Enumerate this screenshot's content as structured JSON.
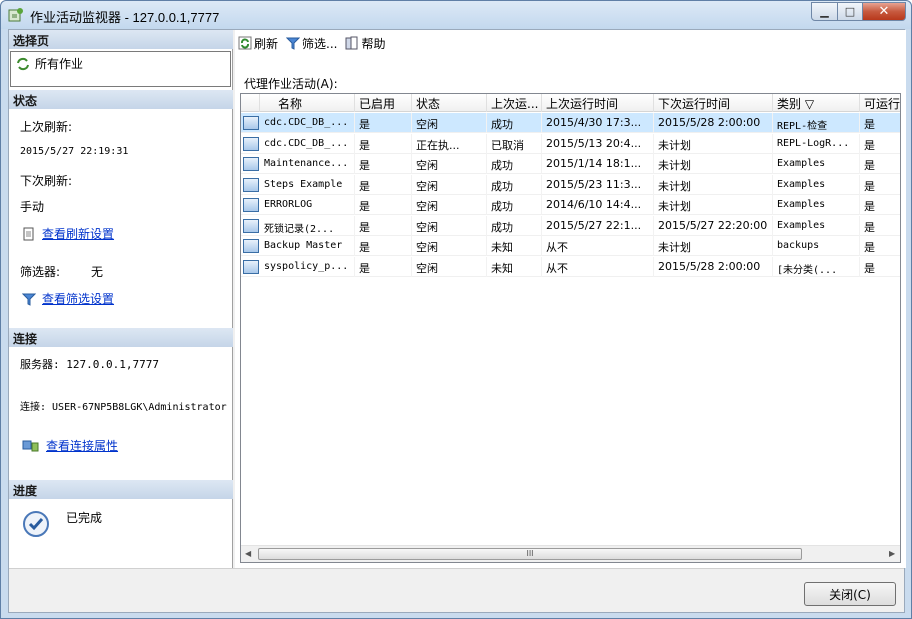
{
  "window": {
    "title": "作业活动监视器 - 127.0.0.1,7777"
  },
  "left": {
    "select_page_header": "选择页",
    "pages": [
      "所有作业"
    ],
    "status_header": "状态",
    "last_refresh_label": "上次刷新:",
    "last_refresh_value": "2015/5/27 22:19:31",
    "next_refresh_label": "下次刷新:",
    "next_refresh_value": "手动",
    "view_refresh_settings": "查看刷新设置",
    "filter_label": "筛选器:",
    "filter_value": "无",
    "view_filter_settings": "查看筛选设置",
    "connection_header": "连接",
    "server_text": "服务器: 127.0.0.1,7777",
    "connection_text": "连接: USER-67NP5B8LGK\\Administrator",
    "view_connection_props": "查看连接属性",
    "progress_header": "进度",
    "progress_value": "已完成"
  },
  "toolbar": {
    "refresh": "刷新",
    "filter": "筛选...",
    "help": "帮助"
  },
  "grid": {
    "label": "代理作业活动(A):",
    "columns": [
      "名称",
      "已启用",
      "状态",
      "上次运...",
      "上次运行时间",
      "下次运行时间",
      "类别 ▽",
      "可运行"
    ],
    "rows": [
      [
        "cdc.CDC_DB_...",
        "是",
        "空闲",
        "成功",
        "2015/4/30 17:3...",
        "2015/5/28 2:00:00",
        "REPL-检查",
        "是"
      ],
      [
        "cdc.CDC_DB_...",
        "是",
        "正在执...",
        "已取消",
        "2015/5/13 20:4...",
        "未计划",
        "REPL-LogR...",
        "是"
      ],
      [
        "Maintenance...",
        "是",
        "空闲",
        "成功",
        "2015/1/14 18:1...",
        "未计划",
        "Examples",
        "是"
      ],
      [
        "Steps Example",
        "是",
        "空闲",
        "成功",
        "2015/5/23 11:3...",
        "未计划",
        "Examples",
        "是"
      ],
      [
        "ERRORLOG",
        "是",
        "空闲",
        "成功",
        "2014/6/10 14:4...",
        "未计划",
        "Examples",
        "是"
      ],
      [
        "死锁记录(2...",
        "是",
        "空闲",
        "成功",
        "2015/5/27 22:1...",
        "2015/5/27 22:20:00",
        "Examples",
        "是"
      ],
      [
        "Backup Master",
        "是",
        "空闲",
        "未知",
        "从不",
        "未计划",
        "backups",
        "是"
      ],
      [
        "syspolicy_p...",
        "是",
        "空闲",
        "未知",
        "从不",
        "2015/5/28 2:00:00",
        "[未分类(...",
        "是"
      ]
    ],
    "scroll_thumb": "III"
  },
  "footer": {
    "close": "关闭(C)"
  }
}
